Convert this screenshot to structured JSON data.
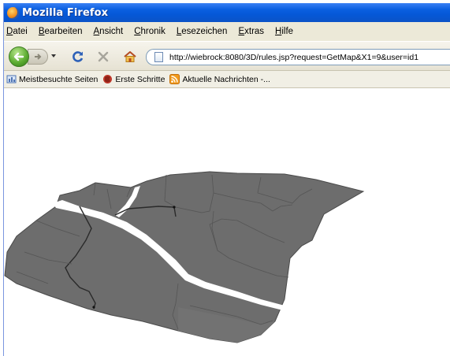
{
  "window": {
    "title": "Mozilla Firefox"
  },
  "menu": {
    "items": [
      {
        "accel": "D",
        "rest": "atei"
      },
      {
        "accel": "B",
        "rest": "earbeiten"
      },
      {
        "accel": "A",
        "rest": "nsicht"
      },
      {
        "accel": "C",
        "rest": "hronik"
      },
      {
        "accel": "L",
        "rest": "esezeichen"
      },
      {
        "accel": "E",
        "rest": "xtras"
      },
      {
        "accel": "H",
        "rest": "ilfe"
      }
    ]
  },
  "navigation": {
    "url": "http://wiebrock:8080/3D/rules.jsp?request=GetMap&X1=9&user=id1"
  },
  "bookmarks": {
    "items": [
      {
        "label": "Meistbesuchte Seiten",
        "icon": "most-visited-icon"
      },
      {
        "label": "Erste Schritte",
        "icon": "firefox-getting-started-icon"
      },
      {
        "label": "Aktuelle Nachrichten -...",
        "icon": "rss-feed-icon"
      }
    ]
  },
  "colors": {
    "titlebar": "#0a5fe0",
    "map_fill": "#6d6d6d",
    "map_edge": "#3f3f3f",
    "road": "#ffffff"
  }
}
